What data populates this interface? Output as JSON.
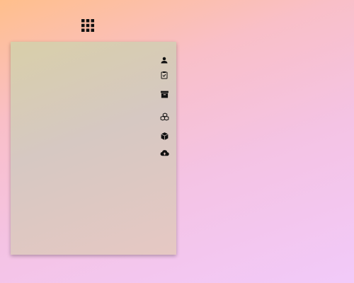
{
  "launcher": {
    "icon": "apps-grid-icon"
  },
  "panel": {
    "icons": [
      {
        "name": "person-icon"
      },
      {
        "name": "clipboard-check-icon"
      },
      {
        "name": "archive-icon"
      },
      {
        "name": "packages-icon"
      },
      {
        "name": "box-icon"
      },
      {
        "name": "cloud-upload-icon"
      }
    ]
  },
  "colors": {
    "icon": "#111111",
    "panel_bg": "#d6c8c2"
  }
}
